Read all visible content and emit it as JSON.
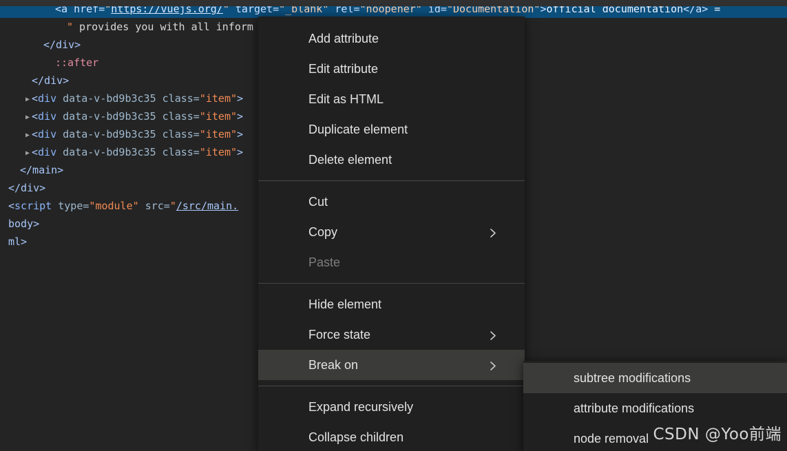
{
  "app": {
    "name": "Chrome DevTools Elements panel with context menu",
    "theme": "dark",
    "selection_color": "#0b4f7d",
    "menu_bg": "#202020",
    "menu_hover": "#3b3b39"
  },
  "dom_tree": {
    "selected_line_index": 0,
    "lines": [
      {
        "indent": 4,
        "twisty": "",
        "selected": true,
        "parts": [
          {
            "t": "punct",
            "v": "<"
          },
          {
            "t": "tag",
            "v": "a"
          },
          {
            "t": "plain",
            "v": " "
          },
          {
            "t": "attr",
            "v": "href="
          },
          {
            "t": "str",
            "v": "\""
          },
          {
            "t": "link",
            "v": "https://vuejs.org/"
          },
          {
            "t": "str",
            "v": "\""
          },
          {
            "t": "plain",
            "v": " "
          },
          {
            "t": "attr",
            "v": "target="
          },
          {
            "t": "str",
            "v": "\"_blank\""
          },
          {
            "t": "plain",
            "v": " "
          },
          {
            "t": "attr",
            "v": "rel="
          },
          {
            "t": "str",
            "v": "\"noopener\""
          },
          {
            "t": "plain",
            "v": " "
          },
          {
            "t": "attr",
            "v": "id="
          },
          {
            "t": "str",
            "v": "\"Documentation\""
          },
          {
            "t": "punct",
            "v": ">"
          },
          {
            "t": "plain",
            "v": "official documentation"
          },
          {
            "t": "punct",
            "v": "</a>"
          },
          {
            "t": "plain",
            "v": " ="
          }
        ]
      },
      {
        "indent": 5,
        "twisty": "",
        "selected": false,
        "parts": [
          {
            "t": "str",
            "v": "\""
          },
          {
            "t": "plain",
            "v": " provides you with all inform"
          }
        ]
      },
      {
        "indent": 3,
        "twisty": "",
        "selected": false,
        "parts": [
          {
            "t": "punct",
            "v": "</div>"
          }
        ]
      },
      {
        "indent": 4,
        "twisty": "",
        "selected": false,
        "parts": [
          {
            "t": "pseudo",
            "v": "::after"
          }
        ]
      },
      {
        "indent": 2,
        "twisty": "",
        "selected": false,
        "parts": [
          {
            "t": "punct",
            "v": "</div>"
          }
        ]
      },
      {
        "indent": 2,
        "twisty": "▶",
        "selected": false,
        "parts": [
          {
            "t": "punct",
            "v": "<"
          },
          {
            "t": "tag",
            "v": "div"
          },
          {
            "t": "plain",
            "v": " "
          },
          {
            "t": "attr",
            "v": "data-v-bd9b3c35"
          },
          {
            "t": "plain",
            "v": " "
          },
          {
            "t": "attr",
            "v": "class="
          },
          {
            "t": "str",
            "v": "\""
          },
          {
            "t": "val",
            "v": "item"
          },
          {
            "t": "str",
            "v": "\""
          },
          {
            "t": "punct",
            "v": ">"
          }
        ]
      },
      {
        "indent": 2,
        "twisty": "▶",
        "selected": false,
        "parts": [
          {
            "t": "punct",
            "v": "<"
          },
          {
            "t": "tag",
            "v": "div"
          },
          {
            "t": "plain",
            "v": " "
          },
          {
            "t": "attr",
            "v": "data-v-bd9b3c35"
          },
          {
            "t": "plain",
            "v": " "
          },
          {
            "t": "attr",
            "v": "class="
          },
          {
            "t": "str",
            "v": "\""
          },
          {
            "t": "val",
            "v": "item"
          },
          {
            "t": "str",
            "v": "\""
          },
          {
            "t": "punct",
            "v": ">"
          }
        ]
      },
      {
        "indent": 2,
        "twisty": "▶",
        "selected": false,
        "parts": [
          {
            "t": "punct",
            "v": "<"
          },
          {
            "t": "tag",
            "v": "div"
          },
          {
            "t": "plain",
            "v": " "
          },
          {
            "t": "attr",
            "v": "data-v-bd9b3c35"
          },
          {
            "t": "plain",
            "v": " "
          },
          {
            "t": "attr",
            "v": "class="
          },
          {
            "t": "str",
            "v": "\""
          },
          {
            "t": "val",
            "v": "item"
          },
          {
            "t": "str",
            "v": "\""
          },
          {
            "t": "punct",
            "v": ">"
          }
        ]
      },
      {
        "indent": 2,
        "twisty": "▶",
        "selected": false,
        "parts": [
          {
            "t": "punct",
            "v": "<"
          },
          {
            "t": "tag",
            "v": "div"
          },
          {
            "t": "plain",
            "v": " "
          },
          {
            "t": "attr",
            "v": "data-v-bd9b3c35"
          },
          {
            "t": "plain",
            "v": " "
          },
          {
            "t": "attr",
            "v": "class="
          },
          {
            "t": "str",
            "v": "\""
          },
          {
            "t": "val",
            "v": "item"
          },
          {
            "t": "str",
            "v": "\""
          },
          {
            "t": "punct",
            "v": ">"
          }
        ]
      },
      {
        "indent": 1,
        "twisty": "",
        "selected": false,
        "parts": [
          {
            "t": "punct",
            "v": "</main>"
          }
        ]
      },
      {
        "indent": 0,
        "twisty": "",
        "selected": false,
        "parts": [
          {
            "t": "punct",
            "v": "</div>"
          }
        ]
      },
      {
        "indent": 0,
        "twisty": "",
        "selected": false,
        "parts": [
          {
            "t": "punct",
            "v": "<"
          },
          {
            "t": "tag",
            "v": "script"
          },
          {
            "t": "plain",
            "v": " "
          },
          {
            "t": "attr",
            "v": "type="
          },
          {
            "t": "str",
            "v": "\""
          },
          {
            "t": "val",
            "v": "module"
          },
          {
            "t": "str",
            "v": "\""
          },
          {
            "t": "plain",
            "v": " "
          },
          {
            "t": "attr",
            "v": "src="
          },
          {
            "t": "str",
            "v": "\""
          },
          {
            "t": "link",
            "v": "/src/main."
          }
        ]
      },
      {
        "indent": 0,
        "twisty": "",
        "selected": false,
        "parts": [
          {
            "t": "punct",
            "v": "body>"
          }
        ]
      },
      {
        "indent": 0,
        "twisty": "",
        "selected": false,
        "parts": [
          {
            "t": "punct",
            "v": "ml>"
          }
        ]
      }
    ]
  },
  "context_menu": {
    "groups": [
      {
        "items": [
          {
            "label": "Add attribute",
            "submenu": false,
            "disabled": false,
            "hover": false
          },
          {
            "label": "Edit attribute",
            "submenu": false,
            "disabled": false,
            "hover": false
          },
          {
            "label": "Edit as HTML",
            "submenu": false,
            "disabled": false,
            "hover": false
          },
          {
            "label": "Duplicate element",
            "submenu": false,
            "disabled": false,
            "hover": false
          },
          {
            "label": "Delete element",
            "submenu": false,
            "disabled": false,
            "hover": false
          }
        ]
      },
      {
        "items": [
          {
            "label": "Cut",
            "submenu": false,
            "disabled": false,
            "hover": false
          },
          {
            "label": "Copy",
            "submenu": true,
            "disabled": false,
            "hover": false
          },
          {
            "label": "Paste",
            "submenu": false,
            "disabled": true,
            "hover": false
          }
        ]
      },
      {
        "items": [
          {
            "label": "Hide element",
            "submenu": false,
            "disabled": false,
            "hover": false
          },
          {
            "label": "Force state",
            "submenu": true,
            "disabled": false,
            "hover": false
          },
          {
            "label": "Break on",
            "submenu": true,
            "disabled": false,
            "hover": true
          }
        ]
      },
      {
        "items": [
          {
            "label": "Expand recursively",
            "submenu": false,
            "disabled": false,
            "hover": false
          },
          {
            "label": "Collapse children",
            "submenu": false,
            "disabled": false,
            "hover": false
          }
        ]
      }
    ]
  },
  "submenu": {
    "parent": "Break on",
    "items": [
      {
        "label": "subtree modifications",
        "hover": true
      },
      {
        "label": "attribute modifications",
        "hover": false
      },
      {
        "label": "node removal",
        "hover": false
      }
    ]
  },
  "watermark": {
    "text": "CSDN @Yoo前端"
  }
}
